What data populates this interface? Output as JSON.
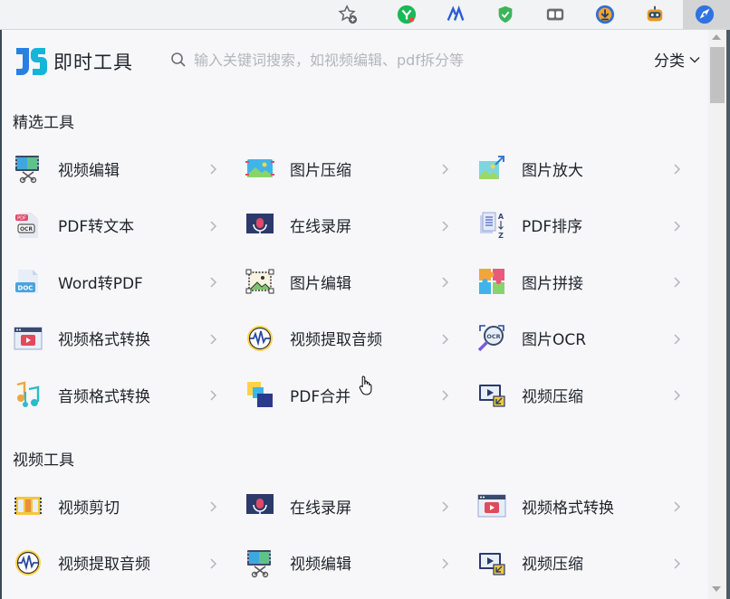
{
  "toolbar": {
    "icons": [
      "bookmark-star-icon",
      "extension-y-icon",
      "extension-logo-icon",
      "extension-shield-icon",
      "extension-reading-icon",
      "extension-download-icon",
      "extension-robot-icon",
      "extension-jishi-icon"
    ]
  },
  "header": {
    "brand": "即时工具",
    "search_placeholder": "输入关键词搜索，如视频编辑、pdf拆分等",
    "category_label": "分类"
  },
  "sections": [
    {
      "title": "精选工具",
      "tools": [
        {
          "label": "视频编辑",
          "icon": "video-edit-icon"
        },
        {
          "label": "图片压缩",
          "icon": "image-compress-icon"
        },
        {
          "label": "图片放大",
          "icon": "image-enlarge-icon"
        },
        {
          "label": "PDF转文本",
          "icon": "pdf-ocr-icon"
        },
        {
          "label": "在线录屏",
          "icon": "screen-record-icon"
        },
        {
          "label": "PDF排序",
          "icon": "pdf-sort-icon"
        },
        {
          "label": "Word转PDF",
          "icon": "word-to-pdf-icon"
        },
        {
          "label": "图片编辑",
          "icon": "image-edit-icon"
        },
        {
          "label": "图片拼接",
          "icon": "image-puzzle-icon"
        },
        {
          "label": "视频格式转换",
          "icon": "video-convert-icon"
        },
        {
          "label": "视频提取音频",
          "icon": "audio-extract-icon"
        },
        {
          "label": "图片OCR",
          "icon": "image-ocr-icon"
        },
        {
          "label": "音频格式转换",
          "icon": "audio-convert-icon"
        },
        {
          "label": "PDF合并",
          "icon": "pdf-merge-icon"
        },
        {
          "label": "视频压缩",
          "icon": "video-compress-icon"
        }
      ]
    },
    {
      "title": "视频工具",
      "tools": [
        {
          "label": "视频剪切",
          "icon": "video-cut-icon"
        },
        {
          "label": "在线录屏",
          "icon": "screen-record-icon"
        },
        {
          "label": "视频格式转换",
          "icon": "video-convert-icon"
        },
        {
          "label": "视频提取音频",
          "icon": "audio-extract-icon"
        },
        {
          "label": "视频编辑",
          "icon": "video-edit-icon"
        },
        {
          "label": "视频压缩",
          "icon": "video-compress-icon"
        }
      ]
    }
  ]
}
